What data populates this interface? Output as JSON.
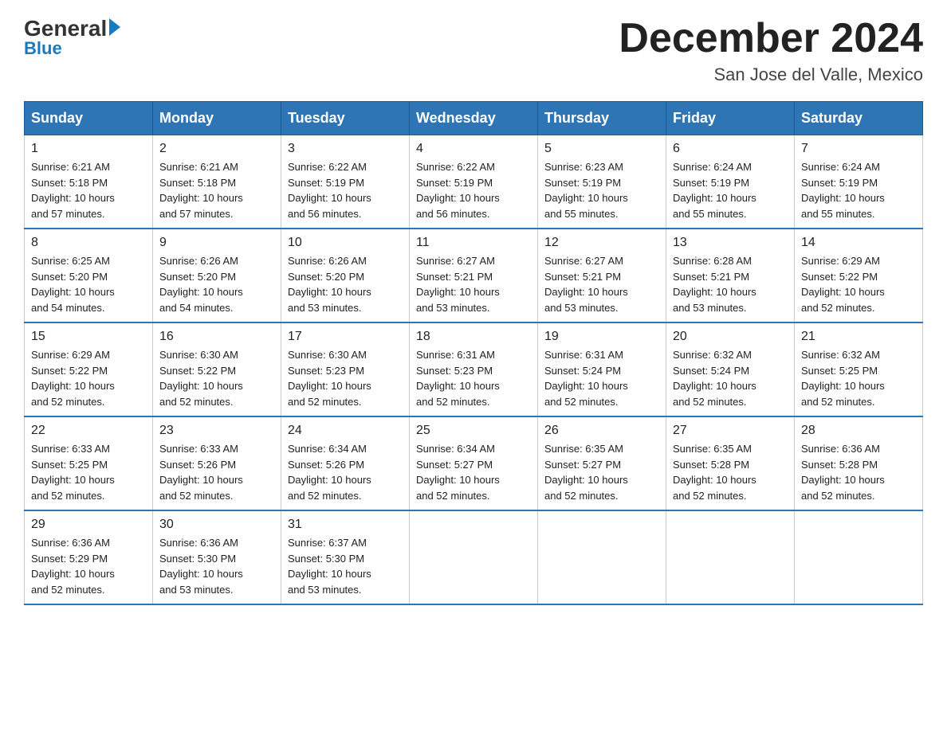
{
  "header": {
    "logo_general": "General",
    "logo_blue": "Blue",
    "month_title": "December 2024",
    "location": "San Jose del Valle, Mexico"
  },
  "days_of_week": [
    "Sunday",
    "Monday",
    "Tuesday",
    "Wednesday",
    "Thursday",
    "Friday",
    "Saturday"
  ],
  "weeks": [
    [
      {
        "date": "1",
        "sunrise": "6:21 AM",
        "sunset": "5:18 PM",
        "daylight": "10 hours and 57 minutes."
      },
      {
        "date": "2",
        "sunrise": "6:21 AM",
        "sunset": "5:18 PM",
        "daylight": "10 hours and 57 minutes."
      },
      {
        "date": "3",
        "sunrise": "6:22 AM",
        "sunset": "5:19 PM",
        "daylight": "10 hours and 56 minutes."
      },
      {
        "date": "4",
        "sunrise": "6:22 AM",
        "sunset": "5:19 PM",
        "daylight": "10 hours and 56 minutes."
      },
      {
        "date": "5",
        "sunrise": "6:23 AM",
        "sunset": "5:19 PM",
        "daylight": "10 hours and 55 minutes."
      },
      {
        "date": "6",
        "sunrise": "6:24 AM",
        "sunset": "5:19 PM",
        "daylight": "10 hours and 55 minutes."
      },
      {
        "date": "7",
        "sunrise": "6:24 AM",
        "sunset": "5:19 PM",
        "daylight": "10 hours and 55 minutes."
      }
    ],
    [
      {
        "date": "8",
        "sunrise": "6:25 AM",
        "sunset": "5:20 PM",
        "daylight": "10 hours and 54 minutes."
      },
      {
        "date": "9",
        "sunrise": "6:26 AM",
        "sunset": "5:20 PM",
        "daylight": "10 hours and 54 minutes."
      },
      {
        "date": "10",
        "sunrise": "6:26 AM",
        "sunset": "5:20 PM",
        "daylight": "10 hours and 53 minutes."
      },
      {
        "date": "11",
        "sunrise": "6:27 AM",
        "sunset": "5:21 PM",
        "daylight": "10 hours and 53 minutes."
      },
      {
        "date": "12",
        "sunrise": "6:27 AM",
        "sunset": "5:21 PM",
        "daylight": "10 hours and 53 minutes."
      },
      {
        "date": "13",
        "sunrise": "6:28 AM",
        "sunset": "5:21 PM",
        "daylight": "10 hours and 53 minutes."
      },
      {
        "date": "14",
        "sunrise": "6:29 AM",
        "sunset": "5:22 PM",
        "daylight": "10 hours and 52 minutes."
      }
    ],
    [
      {
        "date": "15",
        "sunrise": "6:29 AM",
        "sunset": "5:22 PM",
        "daylight": "10 hours and 52 minutes."
      },
      {
        "date": "16",
        "sunrise": "6:30 AM",
        "sunset": "5:22 PM",
        "daylight": "10 hours and 52 minutes."
      },
      {
        "date": "17",
        "sunrise": "6:30 AM",
        "sunset": "5:23 PM",
        "daylight": "10 hours and 52 minutes."
      },
      {
        "date": "18",
        "sunrise": "6:31 AM",
        "sunset": "5:23 PM",
        "daylight": "10 hours and 52 minutes."
      },
      {
        "date": "19",
        "sunrise": "6:31 AM",
        "sunset": "5:24 PM",
        "daylight": "10 hours and 52 minutes."
      },
      {
        "date": "20",
        "sunrise": "6:32 AM",
        "sunset": "5:24 PM",
        "daylight": "10 hours and 52 minutes."
      },
      {
        "date": "21",
        "sunrise": "6:32 AM",
        "sunset": "5:25 PM",
        "daylight": "10 hours and 52 minutes."
      }
    ],
    [
      {
        "date": "22",
        "sunrise": "6:33 AM",
        "sunset": "5:25 PM",
        "daylight": "10 hours and 52 minutes."
      },
      {
        "date": "23",
        "sunrise": "6:33 AM",
        "sunset": "5:26 PM",
        "daylight": "10 hours and 52 minutes."
      },
      {
        "date": "24",
        "sunrise": "6:34 AM",
        "sunset": "5:26 PM",
        "daylight": "10 hours and 52 minutes."
      },
      {
        "date": "25",
        "sunrise": "6:34 AM",
        "sunset": "5:27 PM",
        "daylight": "10 hours and 52 minutes."
      },
      {
        "date": "26",
        "sunrise": "6:35 AM",
        "sunset": "5:27 PM",
        "daylight": "10 hours and 52 minutes."
      },
      {
        "date": "27",
        "sunrise": "6:35 AM",
        "sunset": "5:28 PM",
        "daylight": "10 hours and 52 minutes."
      },
      {
        "date": "28",
        "sunrise": "6:36 AM",
        "sunset": "5:28 PM",
        "daylight": "10 hours and 52 minutes."
      }
    ],
    [
      {
        "date": "29",
        "sunrise": "6:36 AM",
        "sunset": "5:29 PM",
        "daylight": "10 hours and 52 minutes."
      },
      {
        "date": "30",
        "sunrise": "6:36 AM",
        "sunset": "5:30 PM",
        "daylight": "10 hours and 53 minutes."
      },
      {
        "date": "31",
        "sunrise": "6:37 AM",
        "sunset": "5:30 PM",
        "daylight": "10 hours and 53 minutes."
      },
      null,
      null,
      null,
      null
    ]
  ],
  "labels": {
    "sunrise": "Sunrise:",
    "sunset": "Sunset:",
    "daylight": "Daylight:"
  }
}
